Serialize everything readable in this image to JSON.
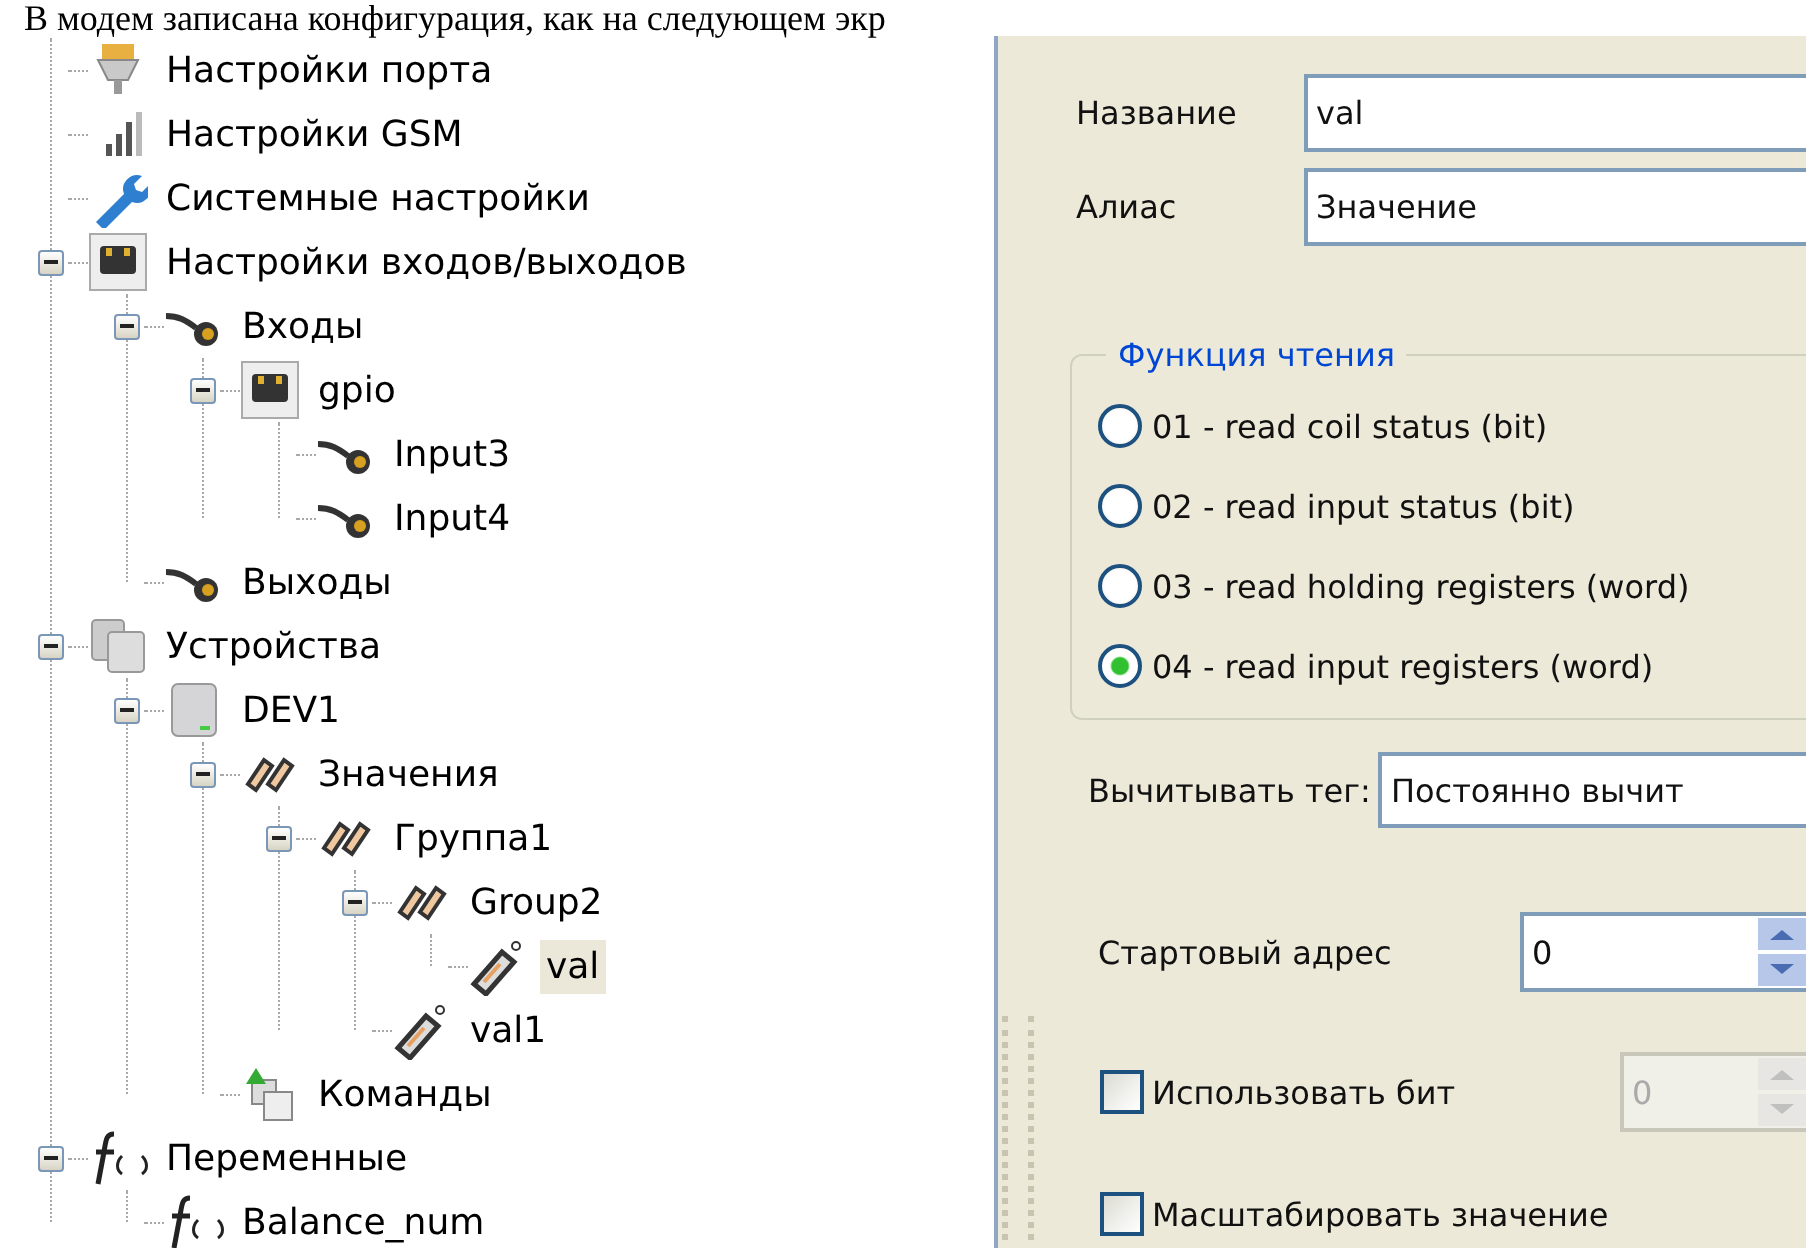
{
  "caption": "В модем записана конфигурация, как на следующем экр",
  "tree": [
    {
      "label": "Настройки порта",
      "kind": "port",
      "selected": false
    },
    {
      "label": "Настройки GSM",
      "kind": "signal",
      "selected": false
    },
    {
      "label": "Системные настройки",
      "kind": "wrench",
      "selected": false
    },
    {
      "label": "Настройки входов/выходов",
      "kind": "socket",
      "selected": false,
      "expanded": true,
      "children": [
        {
          "label": "Входы",
          "kind": "cable",
          "selected": false,
          "expanded": true,
          "children": [
            {
              "label": "gpio",
              "kind": "socket",
              "selected": false,
              "expanded": true,
              "children": [
                {
                  "label": "Input3",
                  "kind": "cable",
                  "selected": false
                },
                {
                  "label": "Input4",
                  "kind": "cable",
                  "selected": false
                }
              ]
            }
          ]
        },
        {
          "label": "Выходы",
          "kind": "cable",
          "selected": false
        }
      ]
    },
    {
      "label": "Устройства",
      "kind": "devices",
      "selected": false,
      "expanded": true,
      "children": [
        {
          "label": "DEV1",
          "kind": "device",
          "selected": false,
          "expanded": true,
          "children": [
            {
              "label": "Значения",
              "kind": "tags",
              "selected": false,
              "expanded": true,
              "children": [
                {
                  "label": "Группа1",
                  "kind": "tags",
                  "selected": false,
                  "expanded": true,
                  "children": [
                    {
                      "label": "Group2",
                      "kind": "tags",
                      "selected": false,
                      "expanded": true,
                      "children": [
                        {
                          "label": "val",
                          "kind": "tag",
                          "selected": true
                        }
                      ]
                    },
                    {
                      "label": "val1",
                      "kind": "tag",
                      "selected": false
                    }
                  ]
                }
              ]
            },
            {
              "label": "Команды",
              "kind": "commands",
              "selected": false
            }
          ]
        }
      ]
    },
    {
      "label": "Переменные",
      "kind": "function",
      "selected": false,
      "expanded": true,
      "children": [
        {
          "label": "Balance_num",
          "kind": "function",
          "selected": false
        }
      ]
    }
  ],
  "form": {
    "name": {
      "label": "Название",
      "value": "val"
    },
    "alias": {
      "label": "Алиас",
      "value": "Значение"
    },
    "read_function": {
      "title": "Функция чтения",
      "options": [
        {
          "label": "01 - read coil status (bit)",
          "selected": false
        },
        {
          "label": "02 - read input status (bit)",
          "selected": false
        },
        {
          "label": "03 - read holding registers (word)",
          "selected": false
        },
        {
          "label": "04 - read input registers (word)",
          "selected": true
        }
      ]
    },
    "read_tag": {
      "label": "Вычитывать тег:",
      "value": "Постоянно вычит"
    },
    "start_address": {
      "label": "Стартовый адрес",
      "value": "0"
    },
    "use_bit": {
      "label": "Использовать бит",
      "checked": false,
      "value": "0",
      "disabled": true
    },
    "scale": {
      "label": "Масштабировать значение",
      "checked": false
    }
  }
}
